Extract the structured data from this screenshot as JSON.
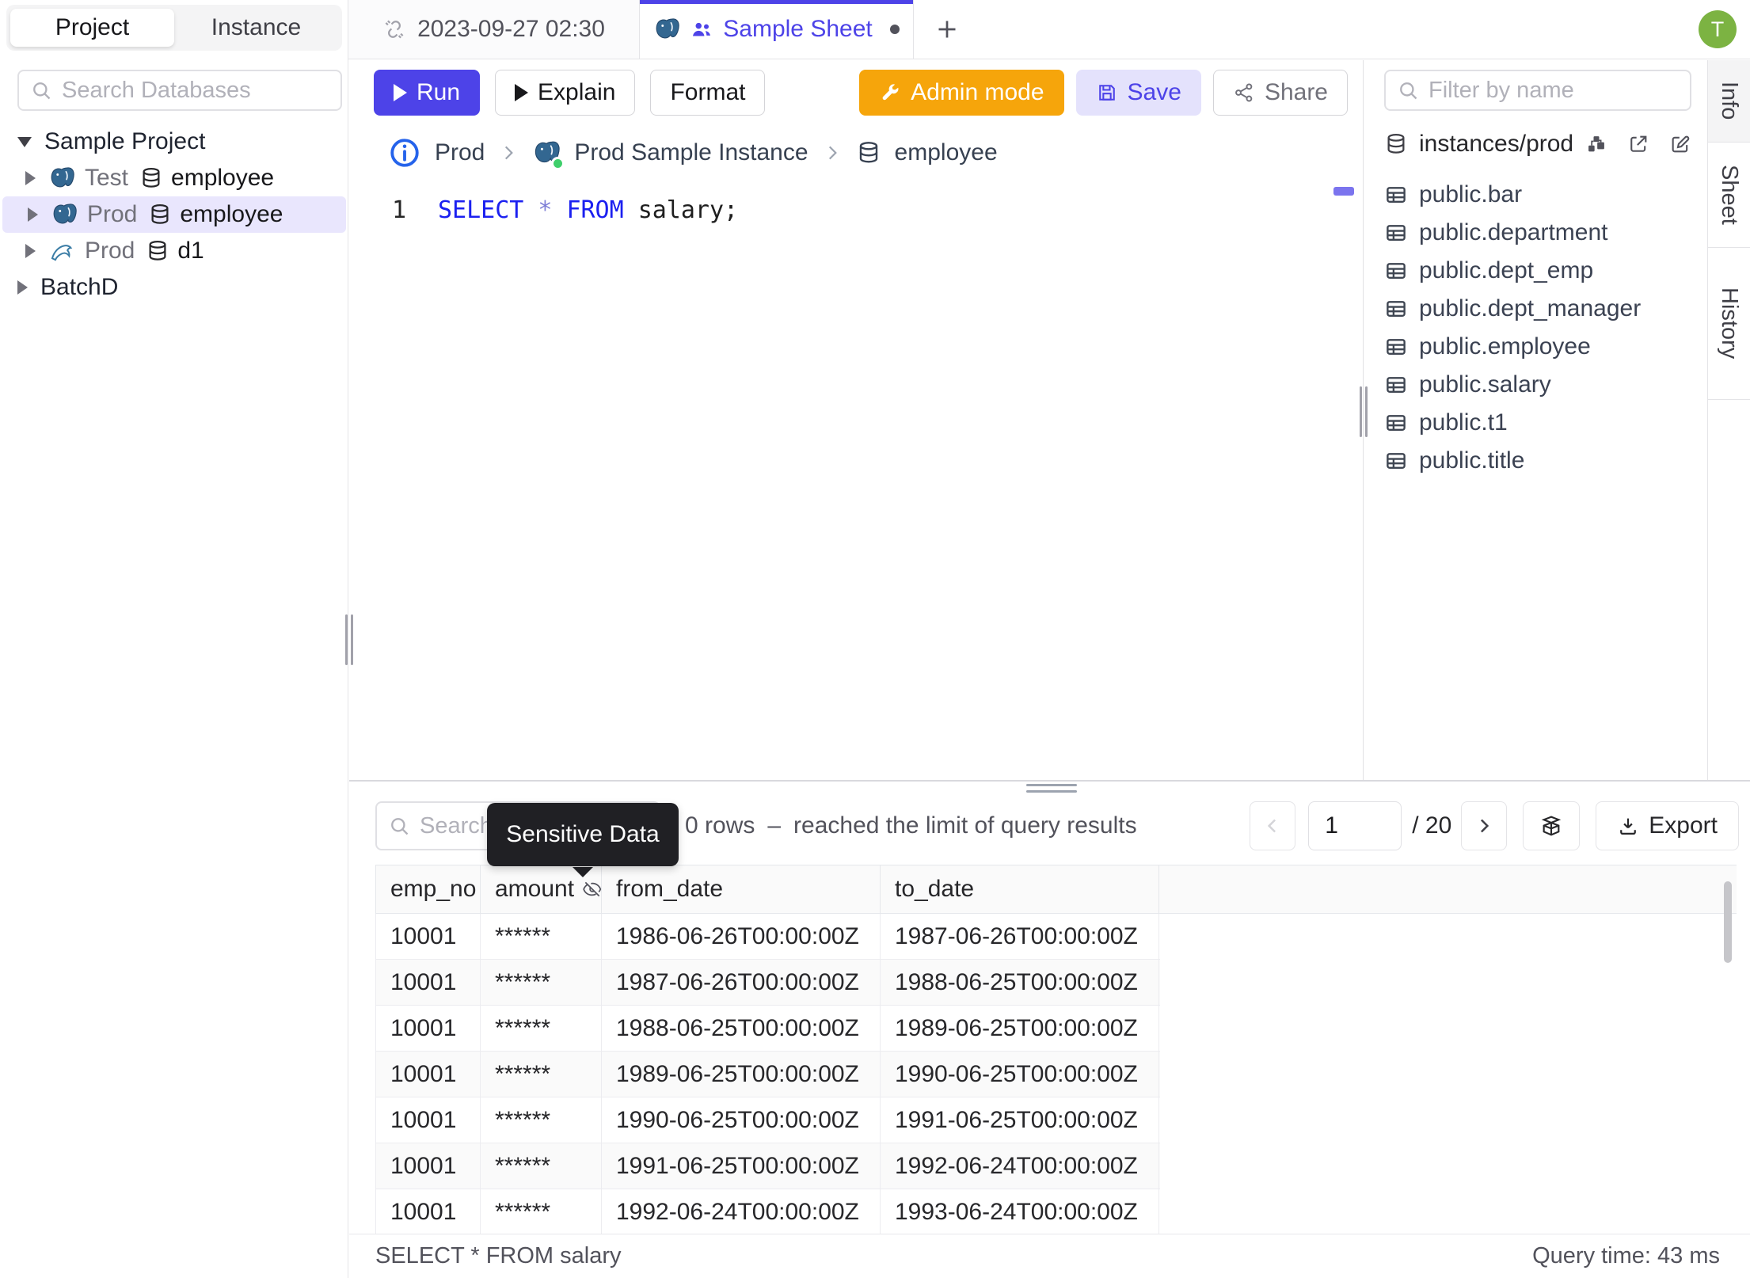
{
  "header": {
    "avatar_initial": "T"
  },
  "sidebar": {
    "tabs": {
      "project": "Project",
      "instance": "Instance"
    },
    "search_placeholder": "Search Databases",
    "tree": {
      "project1": "Sample Project",
      "row_test": {
        "env": "Test",
        "db": "employee"
      },
      "row_prod": {
        "env": "Prod",
        "db": "employee"
      },
      "row_mysql": {
        "env": "Prod",
        "db": "d1"
      },
      "project2": "BatchD"
    }
  },
  "tabs": {
    "tab1": "2023-09-27 02:30",
    "tab2": "Sample Sheet",
    "new_tab": "+"
  },
  "toolbar": {
    "run": "Run",
    "explain": "Explain",
    "format": "Format",
    "admin": "Admin mode",
    "save": "Save",
    "share": "Share"
  },
  "breadcrumb": {
    "env": "Prod",
    "instance": "Prod Sample Instance",
    "database": "employee"
  },
  "editor": {
    "line": "1",
    "kw1": "SELECT",
    "op": "*",
    "kw2": "FROM",
    "rest": "salary;"
  },
  "schema": {
    "filter_placeholder": "Filter by name",
    "connection": "instances/prod",
    "tables": [
      "public.bar",
      "public.department",
      "public.dept_emp",
      "public.dept_manager",
      "public.employee",
      "public.salary",
      "public.t1",
      "public.title"
    ]
  },
  "side_tabs": {
    "info": "Info",
    "sheet": "Sheet",
    "history": "History"
  },
  "results": {
    "search_placeholder": "Search",
    "tooltip": "Sensitive Data",
    "rows_count": "0 rows",
    "dash": "–",
    "limit_note": "reached the limit of query results",
    "page": "1",
    "page_total": "/ 20",
    "export": "Export",
    "columns": {
      "c0": "emp_no",
      "c1": "amount",
      "c2": "from_date",
      "c3": "to_date"
    },
    "rows": [
      [
        "10001",
        "******",
        "1986-06-26T00:00:00Z",
        "1987-06-26T00:00:00Z"
      ],
      [
        "10001",
        "******",
        "1987-06-26T00:00:00Z",
        "1988-06-25T00:00:00Z"
      ],
      [
        "10001",
        "******",
        "1988-06-25T00:00:00Z",
        "1989-06-25T00:00:00Z"
      ],
      [
        "10001",
        "******",
        "1989-06-25T00:00:00Z",
        "1990-06-25T00:00:00Z"
      ],
      [
        "10001",
        "******",
        "1990-06-25T00:00:00Z",
        "1991-06-25T00:00:00Z"
      ],
      [
        "10001",
        "******",
        "1991-06-25T00:00:00Z",
        "1992-06-24T00:00:00Z"
      ],
      [
        "10001",
        "******",
        "1992-06-24T00:00:00Z",
        "1993-06-24T00:00:00Z"
      ]
    ],
    "status_query": "SELECT * FROM salary",
    "query_time": "Query time: 43 ms"
  },
  "colors": {
    "accent": "#4d43e8",
    "admin_orange": "#f6a50b",
    "avatar_green": "#7cb342",
    "info_blue": "#2563eb",
    "postgres_blue": "#336791",
    "status_green": "#3fcf6b",
    "selection": "#e9e6fd"
  }
}
